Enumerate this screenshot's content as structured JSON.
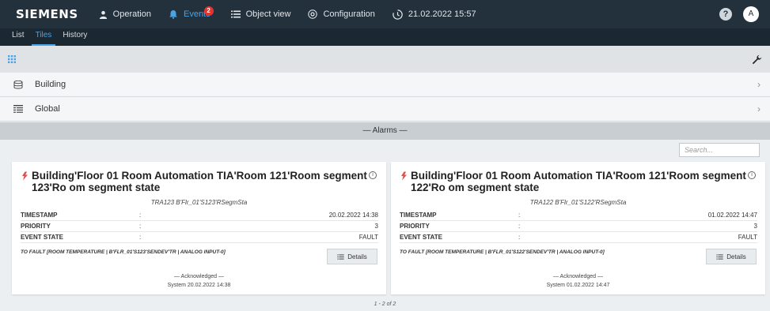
{
  "topbar": {
    "brand": "SIEMENS",
    "nav": [
      {
        "label": "Operation",
        "icon": "person-icon"
      },
      {
        "label": "Events",
        "icon": "bell-icon",
        "badge": "2",
        "active": true
      },
      {
        "label": "Object view",
        "icon": "list-icon"
      },
      {
        "label": "Configuration",
        "icon": "gear-circle-icon"
      },
      {
        "label": "21.02.2022 15:57",
        "icon": "clock-icon"
      }
    ],
    "help": "?",
    "avatar": "A"
  },
  "tabs": [
    "List",
    "Tiles",
    "History"
  ],
  "active_tab": "Tiles",
  "tree": [
    {
      "label": "Building",
      "icon": "stack-icon"
    },
    {
      "label": "Global",
      "icon": "table-icon"
    }
  ],
  "alarms_header": "— Alarms —",
  "search": {
    "placeholder": "Search..."
  },
  "cards": [
    {
      "title": "Building'Floor 01 Room Automation TIA'Room 121'Room segment 123'Ro om segment state",
      "designation": "TRA123 B'Flr_01'S123'RSegmSta",
      "fields": [
        {
          "key": "TIMESTAMP",
          "sep": ":",
          "value": "20.02.2022 14:38"
        },
        {
          "key": "PRIORITY",
          "sep": ":",
          "value": "3"
        },
        {
          "key": "EVENT STATE",
          "sep": ":",
          "value": "FAULT"
        }
      ],
      "message": "TO FAULT [ROOM TEMPERATURE | B'FLR_01'S123'SENDEV'TR | ANALOG INPUT-0]",
      "details_label": "Details",
      "ack_label": "— Acknowledged —",
      "ack_by": "System 20.02.2022 14:38"
    },
    {
      "title": "Building'Floor 01 Room Automation TIA'Room 121'Room segment 122'Ro om segment state",
      "designation": "TRA122 B'Flr_01'S122'RSegmSta",
      "fields": [
        {
          "key": "TIMESTAMP",
          "sep": ":",
          "value": "01.02.2022 14:47"
        },
        {
          "key": "PRIORITY",
          "sep": ":",
          "value": "3"
        },
        {
          "key": "EVENT STATE",
          "sep": ":",
          "value": "FAULT"
        }
      ],
      "message": "TO FAULT [ROOM TEMPERATURE | B'FLR_01'S122'SENDEV'TR | ANALOG INPUT-0]",
      "details_label": "Details",
      "ack_label": "— Acknowledged —",
      "ack_by": "System 01.02.2022 14:47"
    }
  ],
  "pager": "1 - 2 of 2",
  "colors": {
    "accent": "#4aa3e6",
    "topbar": "#23313c",
    "badge": "#e3342f",
    "alarm": "#d9534f"
  }
}
